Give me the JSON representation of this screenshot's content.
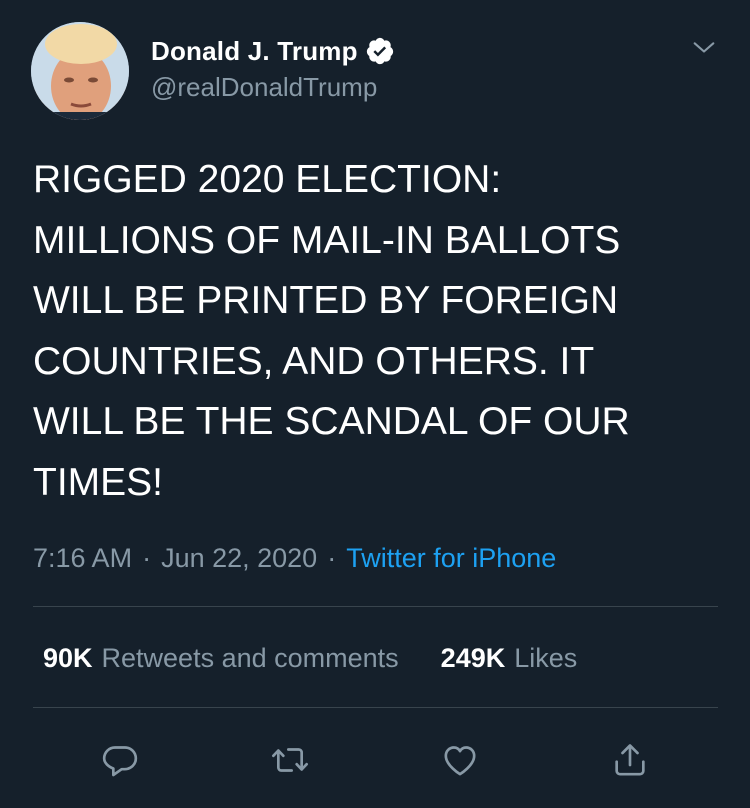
{
  "user": {
    "display_name": "Donald J. Trump",
    "handle": "@realDonaldTrump",
    "verified": true
  },
  "tweet": {
    "text": "RIGGED 2020 ELECTION:\nMILLIONS OF MAIL-IN BALLOTS\nWILL BE PRINTED BY FOREIGN\nCOUNTRIES, AND OTHERS. IT\nWILL BE THE SCANDAL OF OUR\nTIMES!",
    "time": "7:16 AM",
    "date": "Jun 22, 2020",
    "source": "Twitter for iPhone"
  },
  "stats": {
    "retweets_count": "90K",
    "retweets_label": "Retweets and comments",
    "likes_count": "249K",
    "likes_label": "Likes"
  },
  "actions": [
    {
      "name": "reply-icon"
    },
    {
      "name": "retweet-icon"
    },
    {
      "name": "like-icon"
    },
    {
      "name": "share-icon"
    }
  ],
  "colors": {
    "background": "#15202b",
    "text": "#ffffff",
    "secondary_text": "#8899a6",
    "link": "#1da1f2",
    "divider": "#38444d"
  }
}
